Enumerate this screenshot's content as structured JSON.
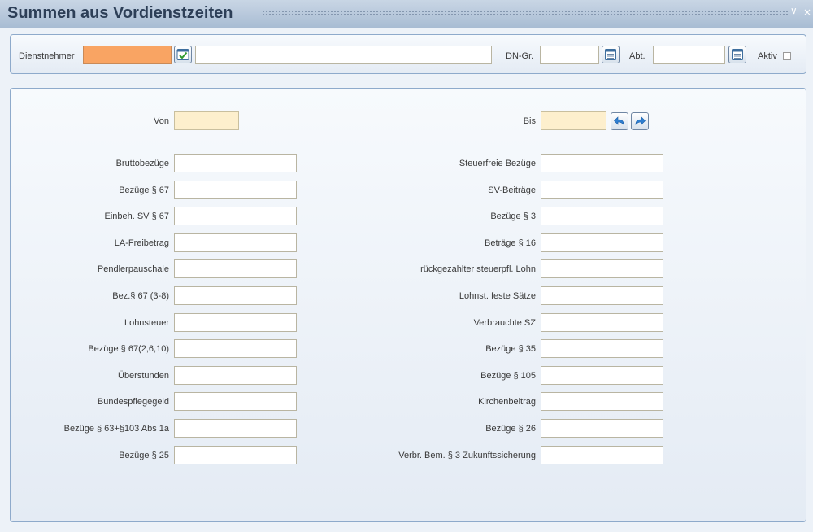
{
  "window": {
    "title": "Summen aus Vordienstzeiten",
    "minimize_glyph": "⊻",
    "close_glyph": "×"
  },
  "header": {
    "dienstnehmer_label": "Dienstnehmer",
    "dienstnehmer_id": "",
    "dienstnehmer_name": "",
    "dngr_label": "DN-Gr.",
    "dngr_value": "",
    "abt_label": "Abt.",
    "abt_value": "",
    "aktiv_label": "Aktiv"
  },
  "period": {
    "von_label": "Von",
    "von_value": "",
    "bis_label": "Bis",
    "bis_value": ""
  },
  "left_fields": [
    {
      "label": "Bruttobezüge",
      "value": ""
    },
    {
      "label": "Bezüge § 67",
      "value": ""
    },
    {
      "label": "Einbeh. SV § 67",
      "value": ""
    },
    {
      "label": "LA-Freibetrag",
      "value": ""
    },
    {
      "label": "Pendlerpauschale",
      "value": ""
    },
    {
      "label": "Bez.§ 67 (3-8)",
      "value": ""
    },
    {
      "label": "Lohnsteuer",
      "value": ""
    },
    {
      "label": "Bezüge § 67(2,6,10)",
      "value": ""
    },
    {
      "label": "Überstunden",
      "value": ""
    },
    {
      "label": "Bundespflegegeld",
      "value": ""
    },
    {
      "label": "Bezüge § 63+§103 Abs 1a",
      "value": ""
    },
    {
      "label": "Bezüge § 25",
      "value": ""
    }
  ],
  "right_fields": [
    {
      "label": "Steuerfreie Bezüge",
      "value": ""
    },
    {
      "label": "SV-Beiträge",
      "value": ""
    },
    {
      "label": "Bezüge § 3",
      "value": ""
    },
    {
      "label": "Beträge § 16",
      "value": ""
    },
    {
      "label": "rückgezahlter steuerpfl. Lohn",
      "value": ""
    },
    {
      "label": "Lohnst. feste Sätze",
      "value": ""
    },
    {
      "label": "Verbrauchte SZ",
      "value": ""
    },
    {
      "label": "Bezüge § 35",
      "value": ""
    },
    {
      "label": "Bezüge § 105",
      "value": ""
    },
    {
      "label": "Kirchenbeitrag",
      "value": ""
    },
    {
      "label": "Bezüge § 26",
      "value": ""
    },
    {
      "label": "Verbr. Bem. § 3 Zukunftssicherung",
      "value": ""
    }
  ],
  "colors": {
    "title_text": "#2d3f57",
    "required_field": "#f9a463",
    "date_field": "#fdefcd",
    "panel_border": "#8eaacb"
  },
  "icons": {
    "search": "check-search-icon",
    "dngr_lookup": "list-lookup-icon",
    "abt_lookup": "list-lookup-icon",
    "prev": "arrow-back-icon",
    "next": "arrow-forward-icon"
  }
}
